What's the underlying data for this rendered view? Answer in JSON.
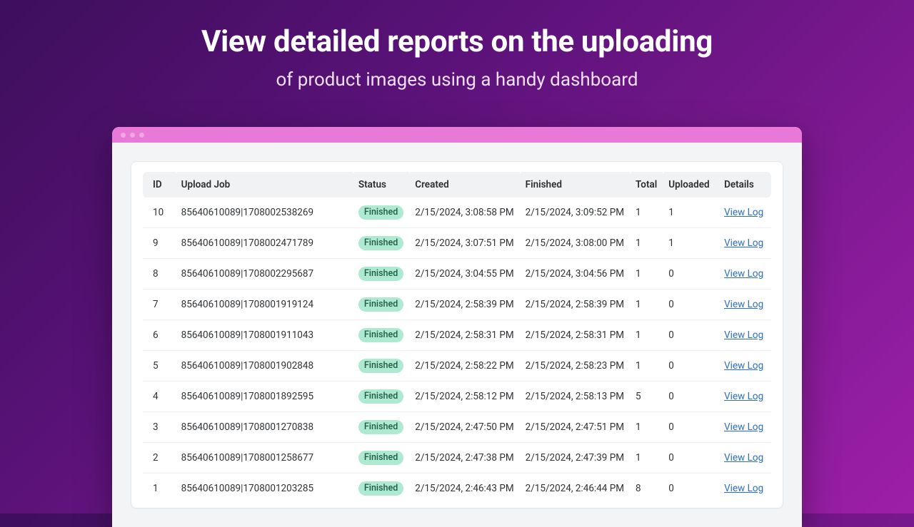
{
  "hero": {
    "title": "View detailed reports on the uploading",
    "subtitle": "of product images using a handy dashboard"
  },
  "table": {
    "headers": {
      "id": "ID",
      "job": "Upload Job",
      "status": "Status",
      "created": "Created",
      "finished": "Finished",
      "total": "Total",
      "uploaded": "Uploaded",
      "details": "Details"
    },
    "rows": [
      {
        "id": "10",
        "job": "85640610089|1708002538269",
        "status": "Finished",
        "created": "2/15/2024, 3:08:58 PM",
        "finished": "2/15/2024, 3:09:52 PM",
        "total": "1",
        "uploaded": "1",
        "details": "View Log"
      },
      {
        "id": "9",
        "job": "85640610089|1708002471789",
        "status": "Finished",
        "created": "2/15/2024, 3:07:51 PM",
        "finished": "2/15/2024, 3:08:00 PM",
        "total": "1",
        "uploaded": "1",
        "details": "View Log"
      },
      {
        "id": "8",
        "job": "85640610089|1708002295687",
        "status": "Finished",
        "created": "2/15/2024, 3:04:55 PM",
        "finished": "2/15/2024, 3:04:56 PM",
        "total": "1",
        "uploaded": "0",
        "details": "View Log"
      },
      {
        "id": "7",
        "job": "85640610089|1708001919124",
        "status": "Finished",
        "created": "2/15/2024, 2:58:39 PM",
        "finished": "2/15/2024, 2:58:39 PM",
        "total": "1",
        "uploaded": "0",
        "details": "View Log"
      },
      {
        "id": "6",
        "job": "85640610089|1708001911043",
        "status": "Finished",
        "created": "2/15/2024, 2:58:31 PM",
        "finished": "2/15/2024, 2:58:31 PM",
        "total": "1",
        "uploaded": "0",
        "details": "View Log"
      },
      {
        "id": "5",
        "job": "85640610089|1708001902848",
        "status": "Finished",
        "created": "2/15/2024, 2:58:22 PM",
        "finished": "2/15/2024, 2:58:23 PM",
        "total": "1",
        "uploaded": "0",
        "details": "View Log"
      },
      {
        "id": "4",
        "job": "85640610089|1708001892595",
        "status": "Finished",
        "created": "2/15/2024, 2:58:12 PM",
        "finished": "2/15/2024, 2:58:13 PM",
        "total": "5",
        "uploaded": "0",
        "details": "View Log"
      },
      {
        "id": "3",
        "job": "85640610089|1708001270838",
        "status": "Finished",
        "created": "2/15/2024, 2:47:50 PM",
        "finished": "2/15/2024, 2:47:51 PM",
        "total": "1",
        "uploaded": "0",
        "details": "View Log"
      },
      {
        "id": "2",
        "job": "85640610089|1708001258677",
        "status": "Finished",
        "created": "2/15/2024, 2:47:38 PM",
        "finished": "2/15/2024, 2:47:39 PM",
        "total": "1",
        "uploaded": "0",
        "details": "View Log"
      },
      {
        "id": "1",
        "job": "85640610089|1708001203285",
        "status": "Finished",
        "created": "2/15/2024, 2:46:43 PM",
        "finished": "2/15/2024, 2:46:44 PM",
        "total": "8",
        "uploaded": "0",
        "details": "View Log"
      }
    ]
  }
}
